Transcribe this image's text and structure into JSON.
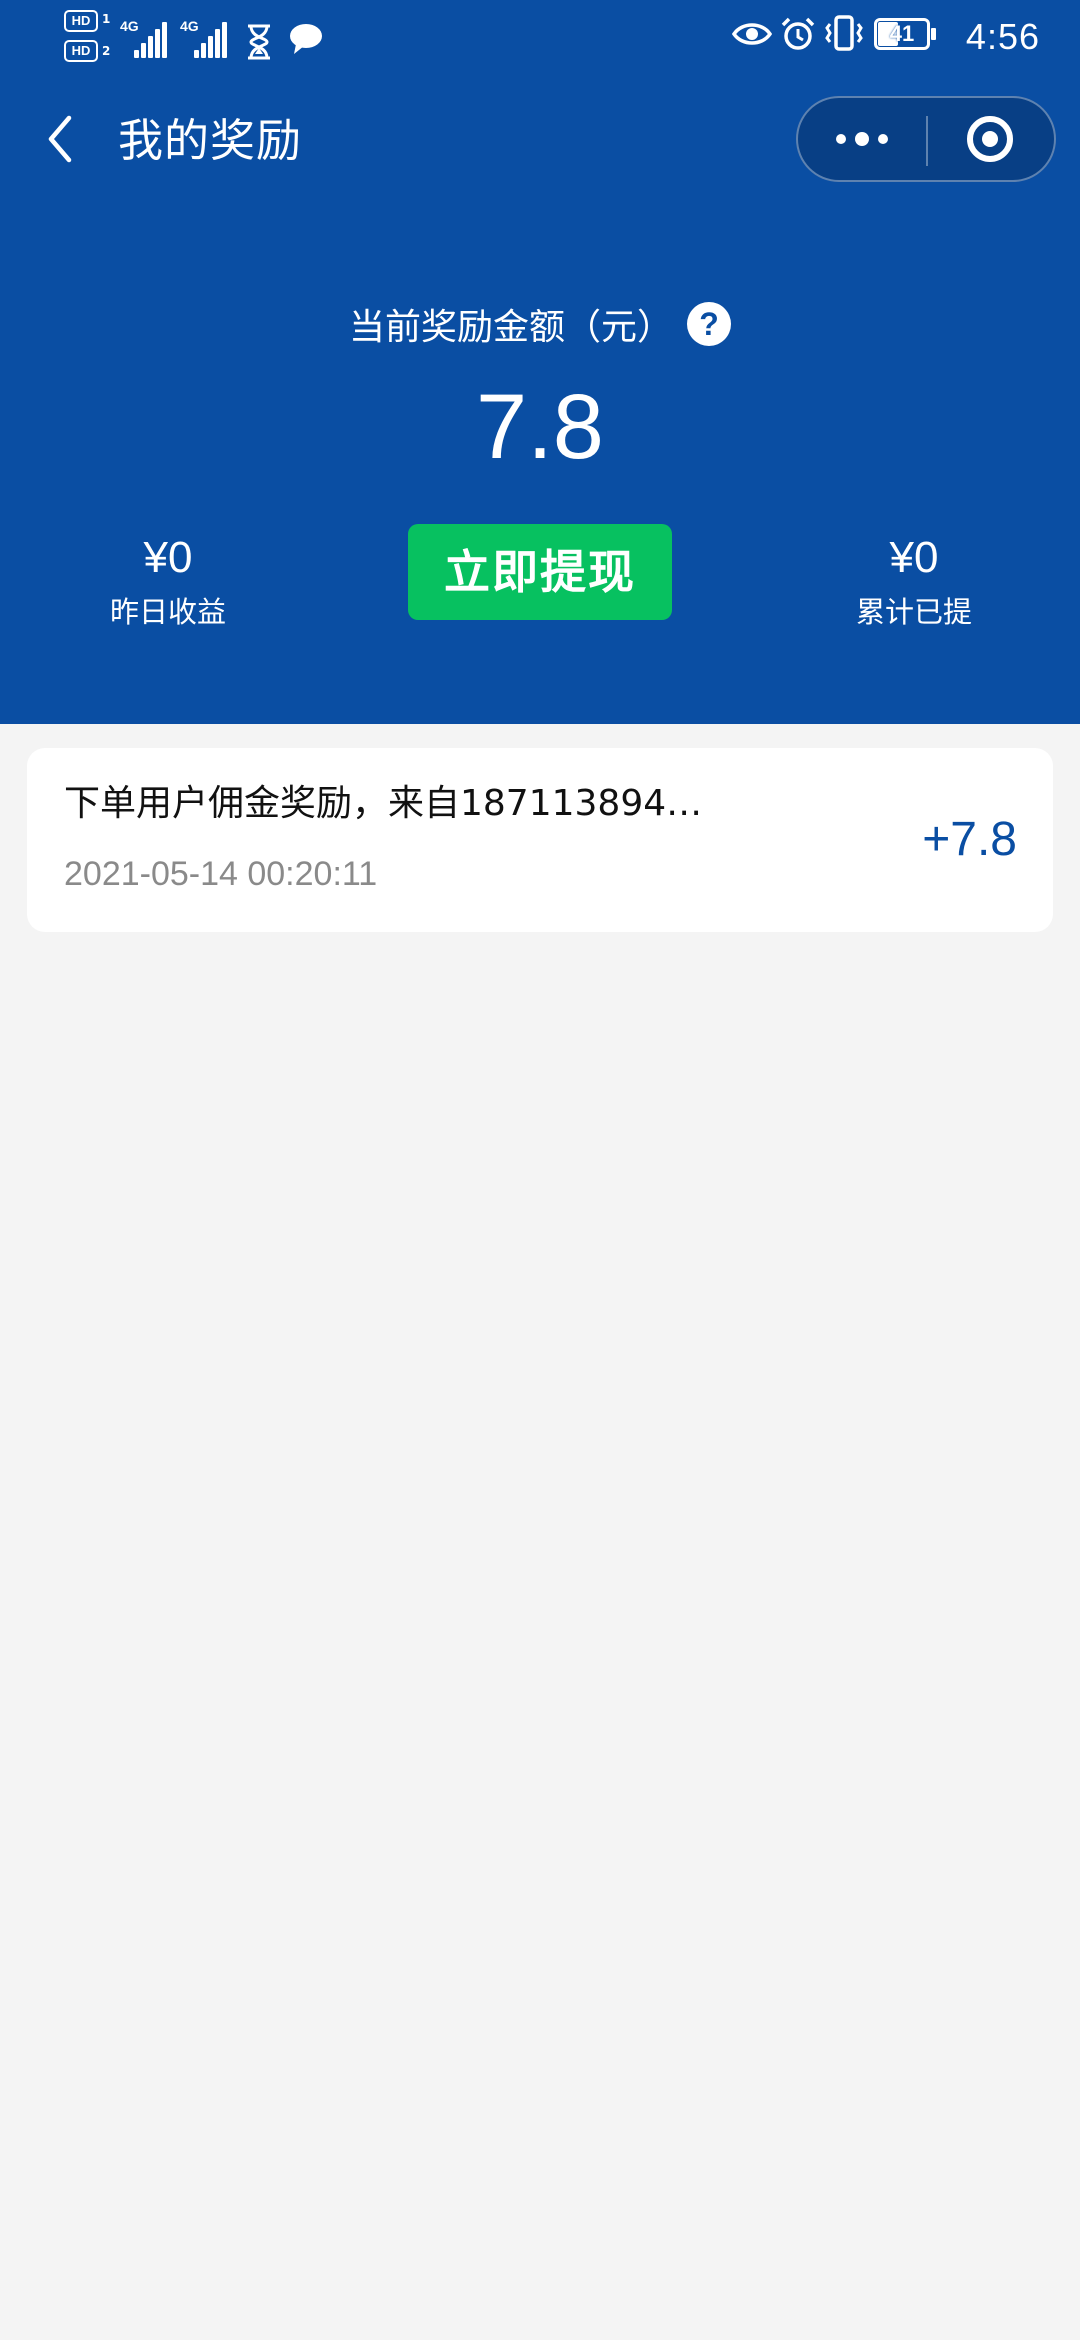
{
  "status_bar": {
    "hd1": "HD",
    "hd1_sub": "1",
    "hd2": "HD",
    "hd2_sub": "2",
    "sim1_network": "4G",
    "sim2_network": "4G",
    "battery": "41",
    "time": "4:56",
    "icons": [
      "hourglass-icon",
      "chat-bubble-icon",
      "eye-icon",
      "alarm-icon",
      "vibrate-icon",
      "battery-icon"
    ]
  },
  "nav": {
    "back_icon": "chevron-left-icon",
    "title": "我的奖励",
    "more_icon": "more-dots-icon",
    "close_icon": "target-ring-icon"
  },
  "balance": {
    "label": "当前奖励金额（元）",
    "help_icon_text": "?",
    "amount": "7.8"
  },
  "stats": {
    "yesterday_value": "¥0",
    "yesterday_label": "昨日收益",
    "total_withdrawn_value": "¥0",
    "total_withdrawn_label": "累计已提"
  },
  "actions": {
    "withdraw_label": "立即提现"
  },
  "records": [
    {
      "title": "下单用户佣金奖励，来自187113894…",
      "time": "2021-05-14 00:20:11",
      "amount": "+7.8"
    }
  ],
  "colors": {
    "header_blue": "#0a4ea3",
    "button_green": "#07c160",
    "page_background": "#f4f4f4",
    "amount_blue": "#0a4ea3"
  }
}
